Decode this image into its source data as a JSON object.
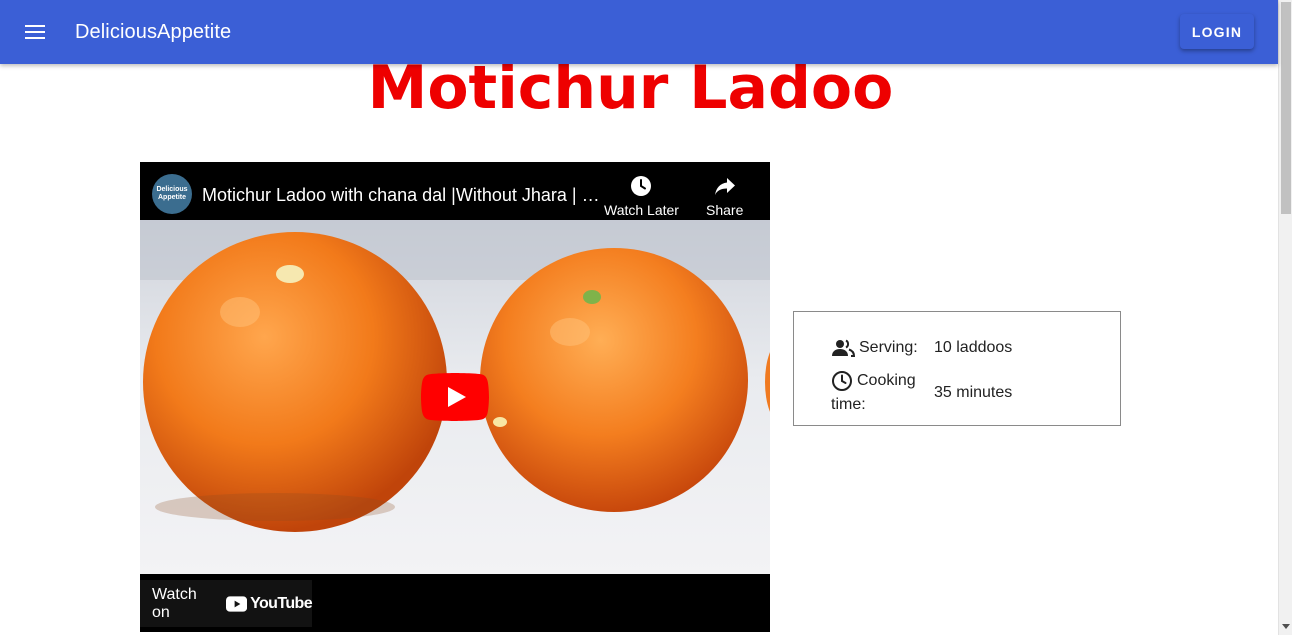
{
  "header": {
    "app_title": "DeliciousAppetite",
    "login_label": "LOGIN",
    "menu_icon": "menu-icon",
    "bar_color": "#3b5fd6"
  },
  "recipe": {
    "title": "Motichur Ladoo",
    "title_color": "#ee0000"
  },
  "video": {
    "title": "Motichur Ladoo with chana dal |Without Jhara | Boondi Ladoo | Motichoor Laddu",
    "channel_avatar_line1": "Delicious",
    "channel_avatar_line2": "Appetite",
    "watch_later_label": "Watch Later",
    "share_label": "Share",
    "watch_on_label": "Watch on",
    "youtube_label": "YouTube"
  },
  "info": {
    "serving_label": "Serving:",
    "serving_value": "10 laddoos",
    "cooking_label_line1": "Cooking",
    "cooking_label_line2": "time:",
    "cooking_value": "35 minutes"
  }
}
